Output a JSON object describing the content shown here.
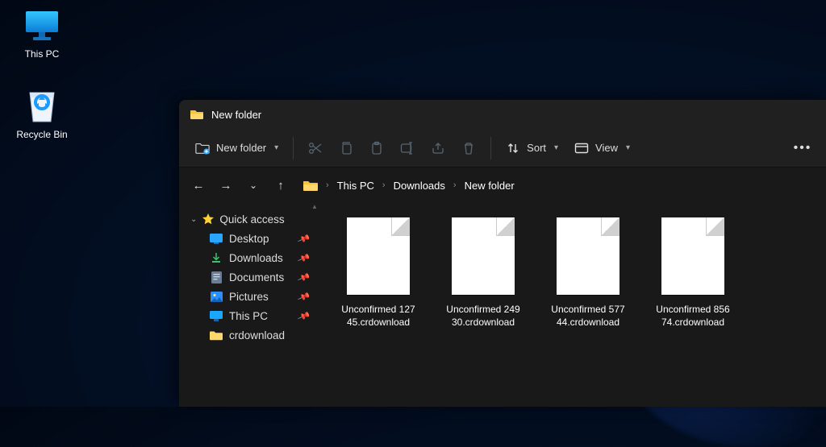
{
  "desktop": {
    "this_pc": "This PC",
    "recycle_bin": "Recycle Bin"
  },
  "window": {
    "title": "New folder",
    "toolbar": {
      "new_folder": "New folder",
      "sort": "Sort",
      "view": "View"
    },
    "breadcrumb": {
      "items": [
        "This PC",
        "Downloads",
        "New folder"
      ]
    },
    "sidebar": {
      "quick_access": "Quick access",
      "items": [
        {
          "label": "Desktop",
          "icon": "desktop"
        },
        {
          "label": "Downloads",
          "icon": "download"
        },
        {
          "label": "Documents",
          "icon": "document"
        },
        {
          "label": "Pictures",
          "icon": "pictures"
        },
        {
          "label": "This PC",
          "icon": "pc"
        },
        {
          "label": "crdownload",
          "icon": "folder"
        }
      ]
    },
    "files": [
      {
        "name": "Unconfirmed 12745.crdownload"
      },
      {
        "name": "Unconfirmed 24930.crdownload"
      },
      {
        "name": "Unconfirmed 57744.crdownload"
      },
      {
        "name": "Unconfirmed 85674.crdownload"
      }
    ]
  }
}
